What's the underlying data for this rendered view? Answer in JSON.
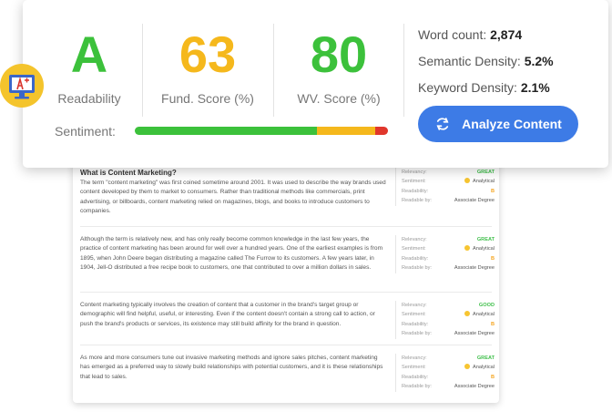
{
  "scores": {
    "readability": {
      "value": "A",
      "label": "Readability",
      "color": "#3cc13b"
    },
    "fund_score": {
      "value": "63",
      "label": "Fund. Score (%)",
      "color": "#f5b81c"
    },
    "wv_score": {
      "value": "80",
      "label": "WV. Score (%)",
      "color": "#3cc13b"
    }
  },
  "stats": {
    "word_count_label": "Word count:",
    "word_count": "2,874",
    "semantic_label": "Semantic Density:",
    "semantic": "5.2%",
    "keyword_label": "Keyword Density:",
    "keyword": "2.1%"
  },
  "analyze_button": "Analyze Content",
  "sentiment": {
    "label": "Sentiment:",
    "segments": [
      {
        "name": "positive",
        "fraction": 0.72,
        "color": "#3cc13b"
      },
      {
        "name": "neutral",
        "fraction": 0.23,
        "color": "#f5b81c"
      },
      {
        "name": "negative",
        "fraction": 0.05,
        "color": "#e0372c"
      }
    ]
  },
  "meta_labels": {
    "relevancy": "Relevancy:",
    "sentiment": "Sentiment:",
    "readability": "Readability:",
    "readable_by": "Readable by:"
  },
  "paragraphs": [
    {
      "title": "What is Content Marketing?",
      "text": "The term \"content marketing\" was first coined sometime around 2001. It was used to describe the way brands used content developed by them to market to consumers. Rather than traditional methods like commercials, print advertising, or billboards, content marketing relied on magazines, blogs, and books to introduce customers to companies.",
      "relevancy": "GREAT",
      "sentiment": "Analytical",
      "readability": "B",
      "readable_by": "Associate Degree"
    },
    {
      "title": "",
      "text": "Although the term is relatively new, and has only really become common knowledge in the last few years, the practice of content marketing has been around for well over a hundred years. One of the earliest examples is from 1895, when John Deere began distributing a magazine called The Furrow to its customers. A few years later, in 1904, Jell-O distributed a free recipe book to customers, one that contributed to over a million dollars in sales.",
      "relevancy": "GREAT",
      "sentiment": "Analytical",
      "readability": "B",
      "readable_by": "Associate Degree"
    },
    {
      "title": "",
      "text": "Content marketing typically involves the creation of content that a customer in the brand's target group or demographic will find helpful, useful, or interesting. Even if the content doesn't contain a strong call to action, or push the brand's products or services, its existence may still build affinity for the brand in question.",
      "relevancy": "GOOD",
      "sentiment": "Analytical",
      "readability": "B",
      "readable_by": "Associate Degree"
    },
    {
      "title": "",
      "text": "As more and more consumers tune out invasive marketing methods and ignore sales pitches, content marketing has emerged as a preferred way to slowly build relationships with potential customers, and it is these relationships that lead to sales.",
      "relevancy": "GREAT",
      "sentiment": "Analytical",
      "readability": "B",
      "readable_by": "Associate Degree"
    }
  ],
  "badge_icon": "document-grade-icon"
}
